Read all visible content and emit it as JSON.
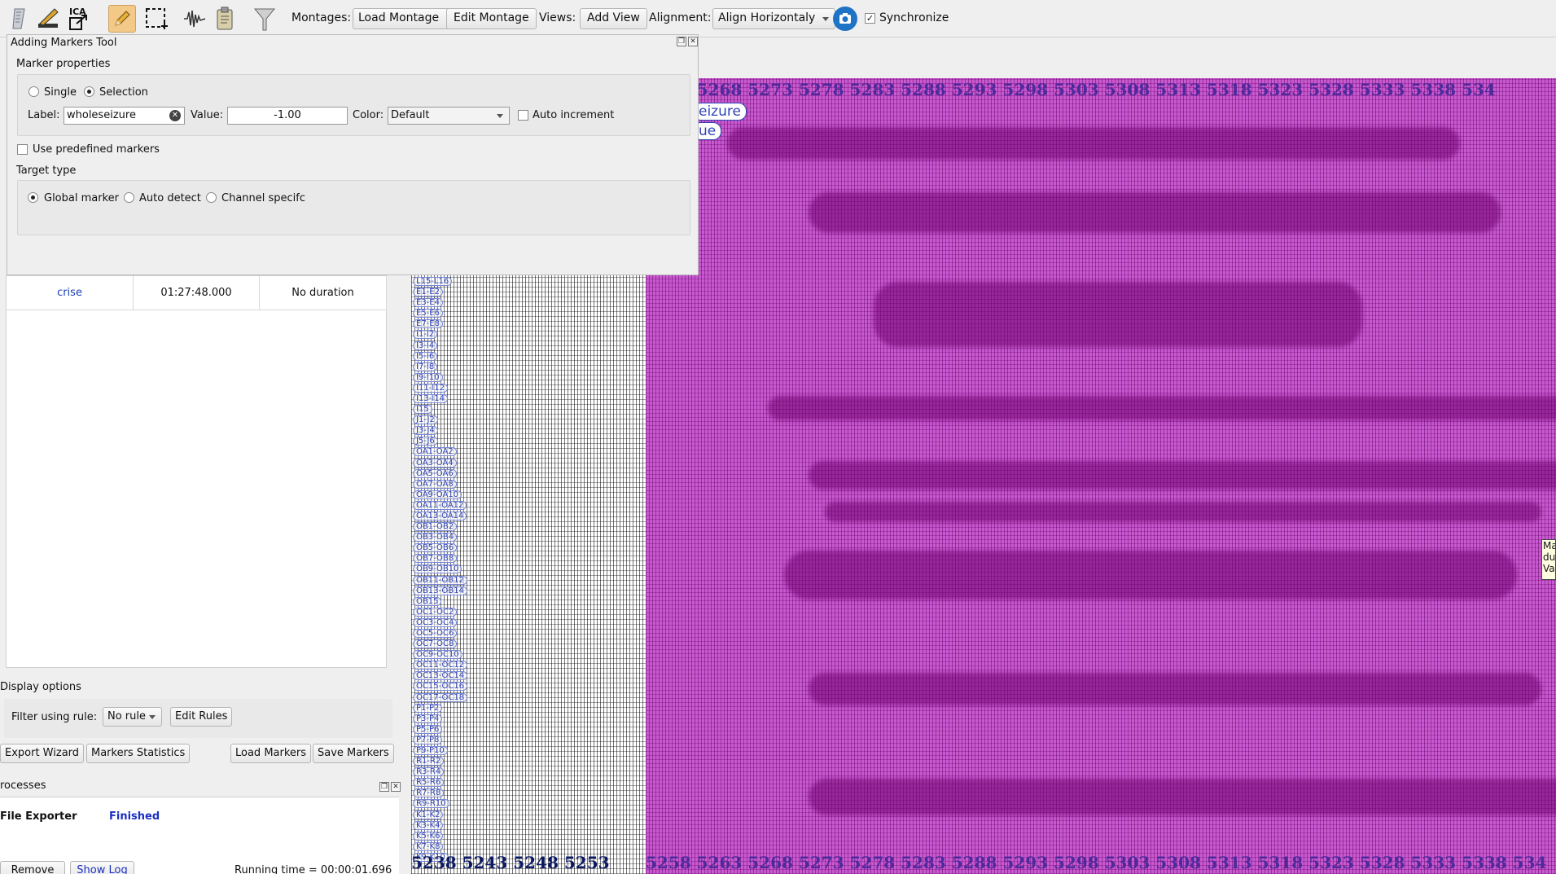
{
  "toolbar": {
    "icons": [
      "ruler-icon",
      "pencil-ruler-icon",
      "ica-export-icon",
      "pencil-icon",
      "selection-rect-icon",
      "waveform-icon",
      "clipboard-icon",
      "filter-funnel-icon"
    ],
    "ica_text": "ICA",
    "montages_label": "Montages:",
    "load_montage": "Load Montage",
    "edit_montage": "Edit Montage",
    "views_label": "Views:",
    "add_view": "Add View",
    "alignment_label": "Alignment:",
    "alignment_value": "Align Horizontaly",
    "synchronize_label": "Synchronize",
    "synchronize_checked": true
  },
  "dialog": {
    "title": "Adding Markers Tool",
    "marker_properties": "Marker properties",
    "single": "Single",
    "selection": "Selection",
    "label_label": "Label:",
    "label_value": "wholeseizure",
    "value_label": "Value:",
    "value_value": "-1.00",
    "color_label": "Color:",
    "color_value": "Default",
    "auto_increment": "Auto increment",
    "use_predefined": "Use predefined markers",
    "target_type": "Target type",
    "global_marker": "Global marker",
    "auto_detect": "Auto detect",
    "channel_specific": "Channel specifc"
  },
  "markers_table": {
    "rows": [
      {
        "name": "crise",
        "time": "01:27:48.000",
        "duration": "No duration"
      }
    ]
  },
  "display_options": {
    "title": "Display options",
    "filter_label": "Filter using rule:",
    "rule_value": "No rule",
    "edit_rules": "Edit Rules"
  },
  "marker_buttons": {
    "export_wizard": "Export Wizard",
    "markers_statistics": "Markers Statistics",
    "load_markers": "Load Markers",
    "save_markers": "Save Markers"
  },
  "processes": {
    "title": "rocesses",
    "name": "File Exporter",
    "status": "Finished",
    "remove": "Remove",
    "show_log": "Show Log",
    "running_time": "Running time = 00:00:01.696"
  },
  "signal": {
    "marker_tag_1": "eizure",
    "marker_tag_2": "ue",
    "bottom_ticks_white": "5238  5243  5248  5253",
    "bottom_ticks_pink": "5258  5263  5268  5273  5278  5283  5288  5293  5298  5303  5308  5313  5318  5323  5328  5333  5338  534",
    "top_ticks_pink": "5263  5268  5273  5278  5283  5288  5293  5298  5303  5308  5313  5318  5323  5328  5333  5338  534",
    "channels": [
      "L15-L16",
      "E1-E2",
      "E3-E4",
      "E5-E6",
      "E7-E8",
      "I1-I2",
      "I3-I4",
      "I5-I6",
      "I7-I8",
      "I9-I10",
      "I11-I12",
      "I13-I14",
      "I15",
      "J1-J2",
      "J3-J4",
      "J5-J6",
      "OA1-OA2",
      "OA3-OA4",
      "OA5-OA6",
      "OA7-OA8",
      "OA9-OA10",
      "OA11-OA12",
      "OA13-OA14",
      "OB1-OB2",
      "OB3-OB4",
      "OB5-OB6",
      "OB7-OB8",
      "OB9-OB10",
      "OB11-OB12",
      "OB13-OB14",
      "OB15",
      "OC1-OC2",
      "OC3-OC4",
      "OC5-OC6",
      "OC7-OC8",
      "OC9-OC10",
      "OC11-OC12",
      "OC13-OC14",
      "OC15-OC16",
      "OC17-OC18",
      "P1-P2",
      "P3-P4",
      "P5-P6",
      "P7-P8",
      "P9-P10",
      "R1-R2",
      "R3-R4",
      "R5-R6",
      "R7-R8",
      "R9-R10",
      "K1-K2",
      "K3-K4",
      "K5-K6",
      "K7-K8",
      "K9-K10"
    ],
    "right_tip": "Ma du Va"
  },
  "colors": {
    "seizure_overlay": "#c85ad0",
    "accent_blue": "#1f73c6",
    "status_blue": "#1b2fc0"
  }
}
